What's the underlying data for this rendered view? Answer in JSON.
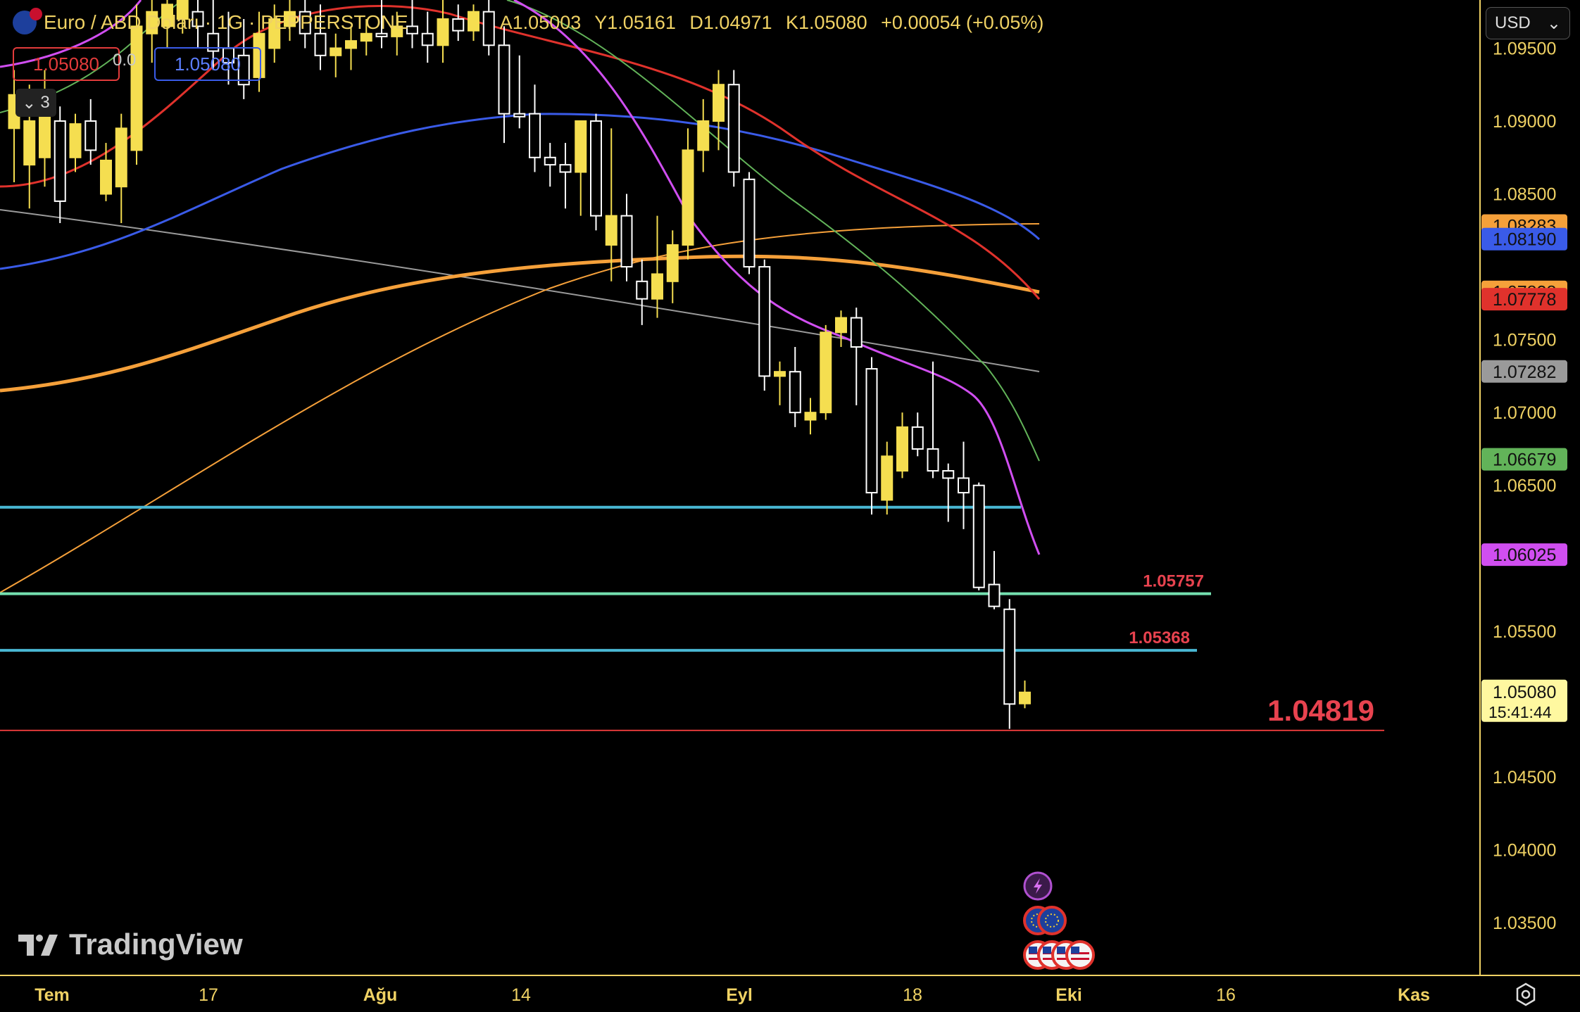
{
  "header": {
    "symbol": "Euro / ABD Doları · 1G · PEPPERSTONE",
    "ohlc": {
      "open": "A1.05003",
      "high": "Y1.05161",
      "low": "D1.04971",
      "close": "K1.05080",
      "change": "+0.00054 (+0.05%)"
    },
    "bid": "1.05080",
    "ask": "1.05080",
    "spread": "0.0",
    "indicator_count": "3"
  },
  "currency": {
    "selected": "USD"
  },
  "watermark": "TradingView",
  "colors": {
    "bull": "#f5de50",
    "bear_fill": "#000000",
    "bear_border": "#ffffff",
    "ma_magenta": "#d04ef0",
    "ma_green": "#62b359",
    "ma_red": "#e0322c",
    "ma_blue": "#3a5be8",
    "ma_orange": "#f5a03a",
    "ma_gray": "#9a9a9a",
    "hline_cyan": "#49b7d3",
    "hline_mint": "#74e0b0",
    "hline_red": "#e03a3a",
    "axis_text": "#f0d264"
  },
  "chart_data": {
    "type": "candlestick",
    "price_axis": {
      "ticks": [
        "1.09500",
        "1.09000",
        "1.08500",
        "1.07500",
        "1.07000",
        "1.06500",
        "1.05500",
        "1.04500",
        "1.04000",
        "1.03500"
      ],
      "ylim": [
        1.0315,
        1.096
      ]
    },
    "time_axis": {
      "ticks": [
        "Tem",
        "17",
        "Ağu",
        "14",
        "Eyl",
        "18",
        "Eki",
        "16",
        "Kas"
      ]
    },
    "last_price": {
      "value": "1.05080",
      "countdown": "15:41:44"
    },
    "price_labels": [
      {
        "value": "1.08283",
        "color": "#f5a03a"
      },
      {
        "value": "1.08190",
        "color": "#3a5be8"
      },
      {
        "value": "1.07828",
        "color": "#f5a03a"
      },
      {
        "value": "1.07778",
        "color": "#e0322c"
      },
      {
        "value": "1.07282",
        "color": "#9a9a9a"
      },
      {
        "value": "1.06679",
        "color": "#62b359"
      },
      {
        "value": "1.06025",
        "color": "#d04ef0"
      }
    ],
    "horizontal_lines": [
      {
        "price": 1.0635,
        "color": "#49b7d3",
        "label": ""
      },
      {
        "price": 1.05757,
        "color": "#74e0b0",
        "label": "1.05757"
      },
      {
        "price": 1.05368,
        "color": "#49b7d3",
        "label": "1.05368"
      },
      {
        "price": 1.04819,
        "color": "#e03a3a",
        "label": "1.04819"
      }
    ],
    "candles": [
      {
        "i": 0,
        "o": 1.0895,
        "h": 1.0935,
        "l": 1.0858,
        "c": 1.0918
      },
      {
        "i": 1,
        "o": 1.087,
        "h": 1.0925,
        "l": 1.084,
        "c": 1.09
      },
      {
        "i": 2,
        "o": 1.0875,
        "h": 1.0935,
        "l": 1.0855,
        "c": 1.0912
      },
      {
        "i": 3,
        "o": 1.09,
        "h": 1.091,
        "l": 1.083,
        "c": 1.0845
      },
      {
        "i": 4,
        "o": 1.0875,
        "h": 1.0905,
        "l": 1.0865,
        "c": 1.0898
      },
      {
        "i": 5,
        "o": 1.09,
        "h": 1.0915,
        "l": 1.087,
        "c": 1.088
      },
      {
        "i": 6,
        "o": 1.085,
        "h": 1.0885,
        "l": 1.0845,
        "c": 1.0873
      },
      {
        "i": 7,
        "o": 1.0855,
        "h": 1.0905,
        "l": 1.083,
        "c": 1.0895
      },
      {
        "i": 8,
        "o": 1.088,
        "h": 1.098,
        "l": 1.087,
        "c": 1.0965
      },
      {
        "i": 9,
        "o": 1.096,
        "h": 1.099,
        "l": 1.094,
        "c": 1.0975
      },
      {
        "i": 10,
        "o": 1.0965,
        "h": 1.099,
        "l": 1.095,
        "c": 1.098
      },
      {
        "i": 11,
        "o": 1.097,
        "h": 1.0995,
        "l": 1.096,
        "c": 1.0985
      },
      {
        "i": 12,
        "o": 1.0975,
        "h": 1.099,
        "l": 1.095,
        "c": 1.0965
      },
      {
        "i": 13,
        "o": 1.096,
        "h": 1.0985,
        "l": 1.0935,
        "c": 1.0948
      },
      {
        "i": 14,
        "o": 1.095,
        "h": 1.0975,
        "l": 1.0925,
        "c": 1.094
      },
      {
        "i": 15,
        "o": 1.0945,
        "h": 1.097,
        "l": 1.0915,
        "c": 1.0925
      },
      {
        "i": 16,
        "o": 1.093,
        "h": 1.0975,
        "l": 1.092,
        "c": 1.096
      },
      {
        "i": 17,
        "o": 1.095,
        "h": 1.098,
        "l": 1.094,
        "c": 1.097
      },
      {
        "i": 18,
        "o": 1.0965,
        "h": 1.0985,
        "l": 1.0955,
        "c": 1.0975
      },
      {
        "i": 19,
        "o": 1.0975,
        "h": 1.099,
        "l": 1.095,
        "c": 1.096
      },
      {
        "i": 20,
        "o": 1.096,
        "h": 1.098,
        "l": 1.0935,
        "c": 1.0945
      },
      {
        "i": 21,
        "o": 1.0945,
        "h": 1.096,
        "l": 1.093,
        "c": 1.095
      },
      {
        "i": 22,
        "o": 1.095,
        "h": 1.0965,
        "l": 1.0935,
        "c": 1.0955
      },
      {
        "i": 23,
        "o": 1.0955,
        "h": 1.097,
        "l": 1.0945,
        "c": 1.096
      },
      {
        "i": 24,
        "o": 1.096,
        "h": 1.099,
        "l": 1.095,
        "c": 1.0958
      },
      {
        "i": 25,
        "o": 1.0958,
        "h": 1.0975,
        "l": 1.0945,
        "c": 1.0965
      },
      {
        "i": 26,
        "o": 1.0965,
        "h": 1.099,
        "l": 1.095,
        "c": 1.096
      },
      {
        "i": 27,
        "o": 1.096,
        "h": 1.0975,
        "l": 1.094,
        "c": 1.0952
      },
      {
        "i": 28,
        "o": 1.0952,
        "h": 1.0985,
        "l": 1.094,
        "c": 1.097
      },
      {
        "i": 29,
        "o": 1.097,
        "h": 1.098,
        "l": 1.0955,
        "c": 1.0962
      },
      {
        "i": 30,
        "o": 1.0962,
        "h": 1.098,
        "l": 1.0955,
        "c": 1.0975
      },
      {
        "i": 31,
        "o": 1.0975,
        "h": 1.0985,
        "l": 1.0945,
        "c": 1.0952
      },
      {
        "i": 32,
        "o": 1.0952,
        "h": 1.0965,
        "l": 1.0885,
        "c": 1.0905
      },
      {
        "i": 33,
        "o": 1.0905,
        "h": 1.0945,
        "l": 1.0895,
        "c": 1.0903
      },
      {
        "i": 34,
        "o": 1.0905,
        "h": 1.0925,
        "l": 1.0865,
        "c": 1.0875
      },
      {
        "i": 35,
        "o": 1.0875,
        "h": 1.0885,
        "l": 1.0855,
        "c": 1.087
      },
      {
        "i": 36,
        "o": 1.087,
        "h": 1.0885,
        "l": 1.084,
        "c": 1.0865
      },
      {
        "i": 37,
        "o": 1.0865,
        "h": 1.088,
        "l": 1.0835,
        "c": 1.09
      },
      {
        "i": 38,
        "o": 1.09,
        "h": 1.0905,
        "l": 1.0825,
        "c": 1.0835
      },
      {
        "i": 39,
        "o": 1.0815,
        "h": 1.0895,
        "l": 1.079,
        "c": 1.0835
      },
      {
        "i": 40,
        "o": 1.0835,
        "h": 1.085,
        "l": 1.079,
        "c": 1.08
      },
      {
        "i": 41,
        "o": 1.079,
        "h": 1.0805,
        "l": 1.076,
        "c": 1.0778
      },
      {
        "i": 42,
        "o": 1.0778,
        "h": 1.0835,
        "l": 1.0765,
        "c": 1.0795
      },
      {
        "i": 43,
        "o": 1.079,
        "h": 1.0825,
        "l": 1.0775,
        "c": 1.0815
      },
      {
        "i": 44,
        "o": 1.0815,
        "h": 1.0895,
        "l": 1.0805,
        "c": 1.088
      },
      {
        "i": 45,
        "o": 1.088,
        "h": 1.0915,
        "l": 1.0865,
        "c": 1.09
      },
      {
        "i": 46,
        "o": 1.09,
        "h": 1.0935,
        "l": 1.088,
        "c": 1.0925
      },
      {
        "i": 47,
        "o": 1.0925,
        "h": 1.0935,
        "l": 1.0855,
        "c": 1.0865
      },
      {
        "i": 48,
        "o": 1.086,
        "h": 1.0865,
        "l": 1.0795,
        "c": 1.08
      },
      {
        "i": 49,
        "o": 1.08,
        "h": 1.0805,
        "l": 1.0715,
        "c": 1.0725
      },
      {
        "i": 50,
        "o": 1.0725,
        "h": 1.0735,
        "l": 1.0705,
        "c": 1.0728
      },
      {
        "i": 51,
        "o": 1.0728,
        "h": 1.0745,
        "l": 1.069,
        "c": 1.07
      },
      {
        "i": 52,
        "o": 1.0695,
        "h": 1.071,
        "l": 1.0685,
        "c": 1.07
      },
      {
        "i": 53,
        "o": 1.07,
        "h": 1.076,
        "l": 1.0695,
        "c": 1.0755
      },
      {
        "i": 54,
        "o": 1.0755,
        "h": 1.077,
        "l": 1.0745,
        "c": 1.0765
      },
      {
        "i": 55,
        "o": 1.0765,
        "h": 1.0772,
        "l": 1.0705,
        "c": 1.0745
      },
      {
        "i": 56,
        "o": 1.073,
        "h": 1.0738,
        "l": 1.063,
        "c": 1.0645
      },
      {
        "i": 57,
        "o": 1.064,
        "h": 1.068,
        "l": 1.063,
        "c": 1.067
      },
      {
        "i": 58,
        "o": 1.066,
        "h": 1.07,
        "l": 1.0655,
        "c": 1.069
      },
      {
        "i": 59,
        "o": 1.069,
        "h": 1.07,
        "l": 1.067,
        "c": 1.0675
      },
      {
        "i": 60,
        "o": 1.0675,
        "h": 1.0735,
        "l": 1.0655,
        "c": 1.066
      },
      {
        "i": 61,
        "o": 1.066,
        "h": 1.0665,
        "l": 1.0625,
        "c": 1.0655
      },
      {
        "i": 62,
        "o": 1.0655,
        "h": 1.068,
        "l": 1.062,
        "c": 1.0645
      },
      {
        "i": 63,
        "o": 1.065,
        "h": 1.0652,
        "l": 1.0578,
        "c": 1.058
      },
      {
        "i": 64,
        "o": 1.0582,
        "h": 1.0605,
        "l": 1.0565,
        "c": 1.0567
      },
      {
        "i": 65,
        "o": 1.0565,
        "h": 1.0572,
        "l": 1.0483,
        "c": 1.05
      },
      {
        "i": 66,
        "o": 1.05003,
        "h": 1.05161,
        "l": 1.04971,
        "c": 1.0508
      }
    ]
  },
  "event_icons": {
    "row1": [
      "lightning-icon"
    ],
    "row2": [
      "eu-flag-icon",
      "eu-flag-icon"
    ],
    "row3": [
      "us-flag-icon",
      "us-flag-icon",
      "us-flag-icon",
      "us-flag-icon"
    ]
  }
}
